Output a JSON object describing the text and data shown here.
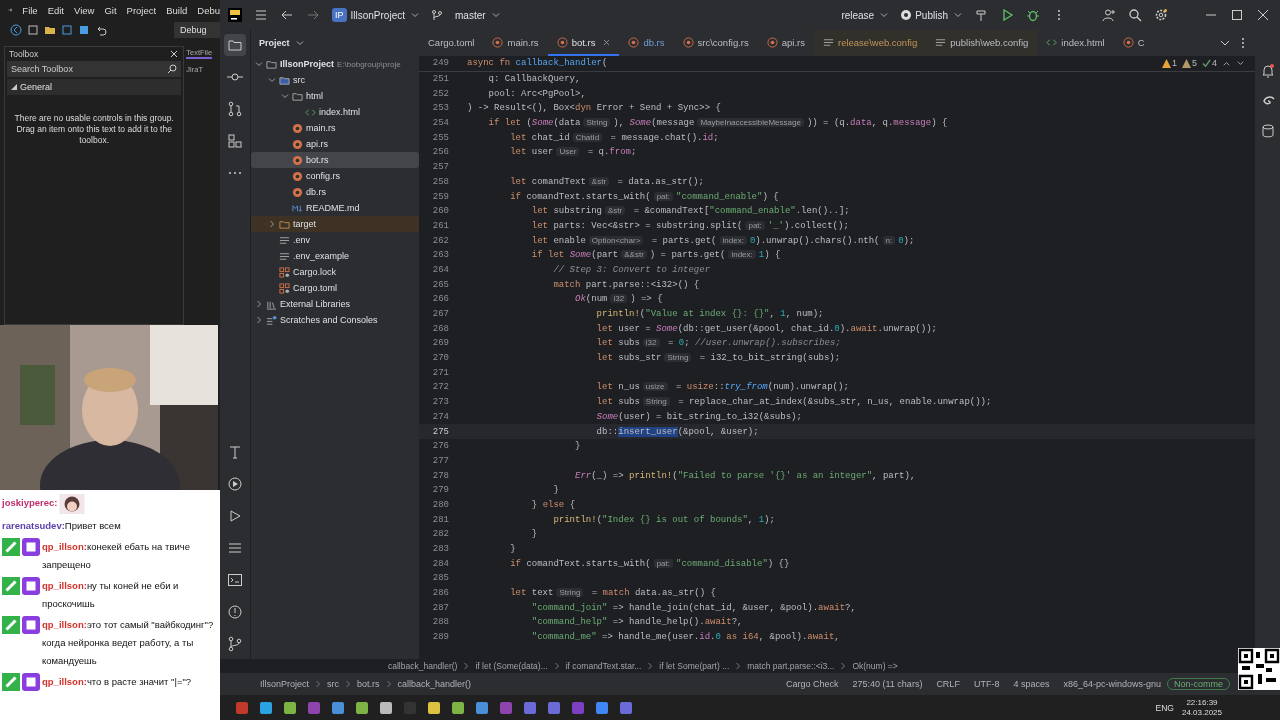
{
  "vs": {
    "menu": [
      "File",
      "Edit",
      "View",
      "Git",
      "Project",
      "Build",
      "Debu"
    ],
    "config": "Debug",
    "toolbox": {
      "title": "Toolbox",
      "search": {
        "placeholder": "Search Toolbox"
      },
      "group": {
        "label": "General",
        "expanded": true
      },
      "message": "There are no usable controls in this group. Drag an item onto this text to add it to the toolbox."
    },
    "side_tab": "TextFile",
    "side_item": "JiraT"
  },
  "chat": [
    {
      "user": "joskiyperec:",
      "color": "#c0306a",
      "badges": false
    },
    {
      "user": "rarenatsudev:",
      "color": "#5b3fb0",
      "text": "Привет всем",
      "badges": false
    },
    {
      "user": "qp_illson:",
      "color": "#d0342c",
      "text": "конекей ебать на твиче запрещено",
      "badges": true
    },
    {
      "user": "qp_illson:",
      "color": "#d0342c",
      "text": "ну ты коней не еби и проскочишь",
      "badges": true
    },
    {
      "user": "qp_illson:",
      "color": "#d0342c",
      "text": "это тот самый \"вайбкодинг\"? когда нейронка ведет работу, а ты командуешь",
      "badges": true
    },
    {
      "user": "qp_illson:",
      "color": "#d0342c",
      "text": "что в расте значит \"|=\"?",
      "badges": true
    }
  ],
  "ide": {
    "project_badge": "IP",
    "project": "IllsonProject",
    "branch": "master",
    "run_config": "release",
    "publish": "Publish",
    "tool_window": "Project",
    "tree": [
      {
        "name": "IllsonProject",
        "path": "E:\\bobgroup\\proje",
        "kind": "folder",
        "expanded": true,
        "selected": false,
        "children": [
          {
            "name": "src",
            "kind": "source",
            "expanded": true,
            "selected": false,
            "children": [
              {
                "name": "html",
                "kind": "folder",
                "expanded": true,
                "selected": false,
                "children": [
                  {
                    "name": "index.html",
                    "kind": "html",
                    "selected": false
                  }
                ]
              },
              {
                "name": "main.rs",
                "kind": "rust",
                "selected": false
              },
              {
                "name": "api.rs",
                "kind": "rust",
                "selected": false
              },
              {
                "name": "bot.rs",
                "kind": "rust",
                "selected": true
              },
              {
                "name": "config.rs",
                "kind": "rust",
                "selected": false
              },
              {
                "name": "db.rs",
                "kind": "rust",
                "selected": false
              },
              {
                "name": "README.md",
                "kind": "markdown",
                "selected": false
              }
            ]
          },
          {
            "name": "target",
            "kind": "excluded",
            "expanded": false,
            "selected": false
          },
          {
            "name": ".env",
            "kind": "text",
            "selected": false
          },
          {
            "name": ".env_example",
            "kind": "text",
            "selected": false
          },
          {
            "name": "Cargo.lock",
            "kind": "cargo",
            "selected": false
          },
          {
            "name": "Cargo.toml",
            "kind": "cargo",
            "selected": false
          }
        ]
      },
      {
        "name": "External Libraries",
        "kind": "library",
        "expanded": false,
        "selected": false
      },
      {
        "name": "Scratches and Consoles",
        "kind": "scratch",
        "expanded": false,
        "selected": false
      }
    ],
    "tabs": [
      {
        "label": "Cargo.toml",
        "kind": "toml",
        "modified": false,
        "ignored": false,
        "selected": false
      },
      {
        "label": "main.rs",
        "kind": "rust",
        "modified": false,
        "ignored": false,
        "selected": false
      },
      {
        "label": "bot.rs",
        "kind": "rust",
        "modified": false,
        "ignored": false,
        "selected": true
      },
      {
        "label": "db.rs",
        "kind": "rust",
        "modified": true,
        "ignored": false,
        "selected": false
      },
      {
        "label": "src\\config.rs",
        "kind": "rust",
        "modified": false,
        "ignored": false,
        "selected": false
      },
      {
        "label": "api.rs",
        "kind": "rust",
        "modified": false,
        "ignored": false,
        "selected": false
      },
      {
        "label": "release\\web.config",
        "kind": "text",
        "modified": false,
        "ignored": true,
        "selected": false
      },
      {
        "label": "publish\\web.config",
        "kind": "text",
        "modified": false,
        "ignored": false,
        "selected": false
      },
      {
        "label": "index.html",
        "kind": "html",
        "modified": false,
        "ignored": false,
        "selected": false
      },
      {
        "label": "C",
        "kind": "rust",
        "modified": false,
        "ignored": false,
        "selected": false
      }
    ],
    "inspections": {
      "errors": "1",
      "warnings": "5",
      "checks": "4"
    },
    "editor": {
      "sticky": {
        "number": "249",
        "tokens": [
          {
            "text": "async fn ",
            "kind": "kw"
          },
          {
            "text": "callback_handler",
            "kind": "fn"
          },
          {
            "text": "(",
            "kind": "p"
          }
        ]
      },
      "lines": [
        {
          "number": "251",
          "current": false,
          "tokens": [
            {
              "text": "    q: CallbackQuery,",
              "kind": "p"
            }
          ]
        },
        {
          "number": "252",
          "current": false,
          "tokens": [
            {
              "text": "    pool: Arc<PgPool>,",
              "kind": "p"
            }
          ]
        },
        {
          "number": "253",
          "current": false,
          "tokens": [
            {
              "text": ") -> Result<(), Box<",
              "kind": "p"
            },
            {
              "text": "dyn",
              "kind": "kw"
            },
            {
              "text": " Error + Send + Sync>> {",
              "kind": "p"
            }
          ]
        },
        {
          "number": "254",
          "current": false,
          "tokens": [
            {
              "text": "    if let",
              "kind": "kw"
            },
            {
              "text": " (",
              "kind": "p"
            },
            {
              "text": "Some",
              "kind": "it"
            },
            {
              "text": "(data",
              "kind": "p"
            },
            {
              "text": "String",
              "kind": "hint"
            },
            {
              "text": "), ",
              "kind": "p"
            },
            {
              "text": "Some",
              "kind": "it"
            },
            {
              "text": "(message",
              "kind": "p"
            },
            {
              "text": "MaybeInaccessibleMessage",
              "kind": "hint"
            },
            {
              "text": ")) = (q.",
              "kind": "p"
            },
            {
              "text": "data",
              "kind": "fld"
            },
            {
              "text": ", q.",
              "kind": "p"
            },
            {
              "text": "message",
              "kind": "fld"
            },
            {
              "text": ") {",
              "kind": "p"
            }
          ]
        },
        {
          "number": "255",
          "current": false,
          "tokens": [
            {
              "text": "        let",
              "kind": "kw"
            },
            {
              "text": " chat_id",
              "kind": "p"
            },
            {
              "text": "ChatId",
              "kind": "hint"
            },
            {
              "text": " = message.chat().",
              "kind": "p"
            },
            {
              "text": "id",
              "kind": "fld"
            },
            {
              "text": ";",
              "kind": "p"
            }
          ]
        },
        {
          "number": "256",
          "current": false,
          "tokens": [
            {
              "text": "        let",
              "kind": "kw"
            },
            {
              "text": " user",
              "kind": "p"
            },
            {
              "text": "User",
              "kind": "hint"
            },
            {
              "text": " = q.",
              "kind": "p"
            },
            {
              "text": "from",
              "kind": "fld"
            },
            {
              "text": ";",
              "kind": "p"
            }
          ]
        },
        {
          "number": "257",
          "current": false
        },
        {
          "number": "258",
          "current": false,
          "tokens": [
            {
              "text": "        let",
              "kind": "kw"
            },
            {
              "text": " comandText",
              "kind": "p"
            },
            {
              "text": "&str",
              "kind": "hint"
            },
            {
              "text": " = data.as_str();",
              "kind": "p"
            }
          ]
        },
        {
          "number": "259",
          "current": false,
          "tokens": [
            {
              "text": "        if",
              "kind": "kw"
            },
            {
              "text": " comandText.starts_with(",
              "kind": "p"
            },
            {
              "text": "pat:",
              "kind": "hint"
            },
            {
              "text": "\"command_enable\"",
              "kind": "str"
            },
            {
              "text": ") {",
              "kind": "p"
            }
          ]
        },
        {
          "number": "260",
          "current": false,
          "tokens": [
            {
              "text": "            let",
              "kind": "kw"
            },
            {
              "text": " substring",
              "kind": "p"
            },
            {
              "text": "&str",
              "kind": "hint"
            },
            {
              "text": " = &comandText[",
              "kind": "p"
            },
            {
              "text": "\"command_enable\"",
              "kind": "str"
            },
            {
              "text": ".len()..];",
              "kind": "p"
            }
          ]
        },
        {
          "number": "261",
          "current": false,
          "tokens": [
            {
              "text": "            let",
              "kind": "kw"
            },
            {
              "text": " parts: Vec<&str> = substring.split(",
              "kind": "p"
            },
            {
              "text": "pat:",
              "kind": "hint"
            },
            {
              "text": "'_'",
              "kind": "str"
            },
            {
              "text": ").collect();",
              "kind": "p"
            }
          ]
        },
        {
          "number": "262",
          "current": false,
          "tokens": [
            {
              "text": "            let",
              "kind": "kw"
            },
            {
              "text": " enable",
              "kind": "p"
            },
            {
              "text": "Option<char>",
              "kind": "hint"
            },
            {
              "text": " = parts.get(",
              "kind": "p"
            },
            {
              "text": "index:",
              "kind": "hint"
            },
            {
              "text": "0",
              "kind": "num"
            },
            {
              "text": ").unwrap().chars().nth(",
              "kind": "p"
            },
            {
              "text": "n:",
              "kind": "hint"
            },
            {
              "text": "0",
              "kind": "num"
            },
            {
              "text": ");",
              "kind": "p"
            }
          ]
        },
        {
          "number": "263",
          "current": false,
          "tokens": [
            {
              "text": "            if let ",
              "kind": "kw"
            },
            {
              "text": "Some",
              "kind": "it"
            },
            {
              "text": "(part",
              "kind": "p"
            },
            {
              "text": "&&str",
              "kind": "hint"
            },
            {
              "text": ") = parts.get(",
              "kind": "p"
            },
            {
              "text": "index:",
              "kind": "hint"
            },
            {
              "text": "1",
              "kind": "num"
            },
            {
              "text": ") {",
              "kind": "p"
            }
          ]
        },
        {
          "number": "264",
          "current": false,
          "tokens": [
            {
              "text": "                // Step 3: Convert to integer",
              "kind": "cm"
            }
          ]
        },
        {
          "number": "265",
          "current": false,
          "tokens": [
            {
              "text": "                match",
              "kind": "kw"
            },
            {
              "text": " part.parse::<i32>() {",
              "kind": "p"
            }
          ]
        },
        {
          "number": "266",
          "current": false,
          "tokens": [
            {
              "text": "                    Ok",
              "kind": "it"
            },
            {
              "text": "(num",
              "kind": "p"
            },
            {
              "text": "i32",
              "kind": "hint"
            },
            {
              "text": ") => {",
              "kind": "p"
            }
          ]
        },
        {
          "number": "267",
          "current": false,
          "tokens": [
            {
              "text": "                        println!",
              "kind": "mac"
            },
            {
              "text": "(",
              "kind": "p"
            },
            {
              "text": "\"Value at index {}: {}\"",
              "kind": "str"
            },
            {
              "text": ", ",
              "kind": "p"
            },
            {
              "text": "1",
              "kind": "num"
            },
            {
              "text": ", num);",
              "kind": "p"
            }
          ]
        },
        {
          "number": "268",
          "current": false,
          "tokens": [
            {
              "text": "                        let",
              "kind": "kw"
            },
            {
              "text": " user = ",
              "kind": "p"
            },
            {
              "text": "Some",
              "kind": "it"
            },
            {
              "text": "(db::get_user(&pool, chat_id.",
              "kind": "p"
            },
            {
              "text": "0",
              "kind": "num"
            },
            {
              "text": ").",
              "kind": "p"
            },
            {
              "text": "await",
              "kind": "kw"
            },
            {
              "text": ".unwrap());",
              "kind": "p"
            }
          ]
        },
        {
          "number": "269",
          "current": false,
          "tokens": [
            {
              "text": "                        let",
              "kind": "kw"
            },
            {
              "text": " subs",
              "kind": "p"
            },
            {
              "text": "i32",
              "kind": "hint"
            },
            {
              "text": " = ",
              "kind": "p"
            },
            {
              "text": "0",
              "kind": "num"
            },
            {
              "text": "; ",
              "kind": "p"
            },
            {
              "text": "//user.unwrap().subscribes;",
              "kind": "cm"
            }
          ]
        },
        {
          "number": "270",
          "current": false,
          "tokens": [
            {
              "text": "                        let",
              "kind": "kw"
            },
            {
              "text": " subs_str",
              "kind": "p"
            },
            {
              "text": "String",
              "kind": "hint"
            },
            {
              "text": " = i32_to_bit_string(subs);",
              "kind": "p"
            }
          ]
        },
        {
          "number": "271",
          "current": false
        },
        {
          "number": "272",
          "current": false,
          "tokens": [
            {
              "text": "                        let",
              "kind": "kw"
            },
            {
              "text": " n_us",
              "kind": "p"
            },
            {
              "text": "usize",
              "kind": "hint"
            },
            {
              "text": " = ",
              "kind": "p"
            },
            {
              "text": "usize",
              "kind": "kw"
            },
            {
              "text": "::",
              "kind": "p"
            },
            {
              "text": "try_from",
              "kind": "call"
            },
            {
              "text": "(num).unwrap();",
              "kind": "p"
            }
          ]
        },
        {
          "number": "273",
          "current": false,
          "tokens": [
            {
              "text": "                        let",
              "kind": "kw"
            },
            {
              "text": " subs",
              "kind": "p"
            },
            {
              "text": "String",
              "kind": "hint"
            },
            {
              "text": " = replace_char_at_index(&subs_str, n_us, enable.unwrap());",
              "kind": "p"
            }
          ]
        },
        {
          "number": "274",
          "current": false,
          "tokens": [
            {
              "text": "                        Some",
              "kind": "it"
            },
            {
              "text": "(user) = bit_string_to_i32(&subs);",
              "kind": "p"
            }
          ]
        },
        {
          "number": "275",
          "current": true,
          "tokens": [
            {
              "text": "                        db::",
              "kind": "p"
            },
            {
              "text": "insert_user",
              "kind": "sel"
            },
            {
              "text": "(&pool, &user);",
              "kind": "p"
            }
          ]
        },
        {
          "number": "276",
          "current": false,
          "tokens": [
            {
              "text": "                    }",
              "kind": "p"
            }
          ]
        },
        {
          "number": "277",
          "current": false
        },
        {
          "number": "278",
          "current": false,
          "tokens": [
            {
              "text": "                    Err",
              "kind": "it"
            },
            {
              "text": "(_) => ",
              "kind": "p"
            },
            {
              "text": "println!",
              "kind": "mac"
            },
            {
              "text": "(",
              "kind": "p"
            },
            {
              "text": "\"Failed to parse '{}' as an integer\"",
              "kind": "str"
            },
            {
              "text": ", part),",
              "kind": "p"
            }
          ]
        },
        {
          "number": "279",
          "current": false,
          "tokens": [
            {
              "text": "                }",
              "kind": "p"
            }
          ]
        },
        {
          "number": "280",
          "current": false,
          "tokens": [
            {
              "text": "            } ",
              "kind": "p"
            },
            {
              "text": "else",
              "kind": "kw"
            },
            {
              "text": " {",
              "kind": "p"
            }
          ]
        },
        {
          "number": "281",
          "current": false,
          "tokens": [
            {
              "text": "                println!",
              "kind": "mac"
            },
            {
              "text": "(",
              "kind": "p"
            },
            {
              "text": "\"Index {} is out of bounds\"",
              "kind": "str"
            },
            {
              "text": ", ",
              "kind": "p"
            },
            {
              "text": "1",
              "kind": "num"
            },
            {
              "text": ");",
              "kind": "p"
            }
          ]
        },
        {
          "number": "282",
          "current": false,
          "tokens": [
            {
              "text": "            }",
              "kind": "p"
            }
          ]
        },
        {
          "number": "283",
          "current": false,
          "tokens": [
            {
              "text": "        }",
              "kind": "p"
            }
          ]
        },
        {
          "number": "284",
          "current": false,
          "tokens": [
            {
              "text": "        if",
              "kind": "kw"
            },
            {
              "text": " comandText.starts_with(",
              "kind": "p"
            },
            {
              "text": "pat:",
              "kind": "hint"
            },
            {
              "text": "\"command_disable\"",
              "kind": "str"
            },
            {
              "text": ") {}",
              "kind": "p"
            }
          ]
        },
        {
          "number": "285",
          "current": false
        },
        {
          "number": "286",
          "current": false,
          "tokens": [
            {
              "text": "        let",
              "kind": "kw"
            },
            {
              "text": " text",
              "kind": "p"
            },
            {
              "text": "String",
              "kind": "hint"
            },
            {
              "text": " = ",
              "kind": "p"
            },
            {
              "text": "match",
              "kind": "kw"
            },
            {
              "text": " data.as_str() {",
              "kind": "p"
            }
          ]
        },
        {
          "number": "287",
          "current": false,
          "tokens": [
            {
              "text": "            \"command_join\"",
              "kind": "str"
            },
            {
              "text": " => handle_join(chat_id, &user, &pool).",
              "kind": "p"
            },
            {
              "text": "await",
              "kind": "kw"
            },
            {
              "text": "?,",
              "kind": "p"
            }
          ]
        },
        {
          "number": "288",
          "current": false,
          "tokens": [
            {
              "text": "            \"command_help\"",
              "kind": "str"
            },
            {
              "text": " => handle_help().",
              "kind": "p"
            },
            {
              "text": "await",
              "kind": "kw"
            },
            {
              "text": "?,",
              "kind": "p"
            }
          ]
        },
        {
          "number": "289",
          "current": false,
          "tokens": [
            {
              "text": "            \"command_me\"",
              "kind": "str"
            },
            {
              "text": " => handle_me(user.",
              "kind": "p"
            },
            {
              "text": "id",
              "kind": "fld"
            },
            {
              "text": ".",
              "kind": "p"
            },
            {
              "text": "0",
              "kind": "num"
            },
            {
              "text": " as i64",
              "kind": "kw"
            },
            {
              "text": ", &pool).",
              "kind": "p"
            },
            {
              "text": "await",
              "kind": "kw"
            },
            {
              "text": ",",
              "kind": "p"
            }
          ]
        }
      ]
    },
    "breadcrumbs": [
      "callback_handler()",
      "if let (Some(data)...",
      "if comandText.star...",
      "if let Some(part) ...",
      "match part.parse::<i3...",
      "Ok(num) =>"
    ],
    "status": {
      "path": [
        "IllsonProject",
        "src",
        "bot.rs",
        "callback_handler()"
      ],
      "cargo_check": "Cargo Check",
      "position": "275:40 (11 chars)",
      "line_endings": "CRLF",
      "encoding": "UTF-8",
      "indent": "4 spaces",
      "target": "x86_64-pc-windows-gnu",
      "mode": "Non-comme"
    }
  },
  "taskbar": {
    "language": "ENG",
    "time": "22:16:39",
    "date": "24.03.2025"
  }
}
